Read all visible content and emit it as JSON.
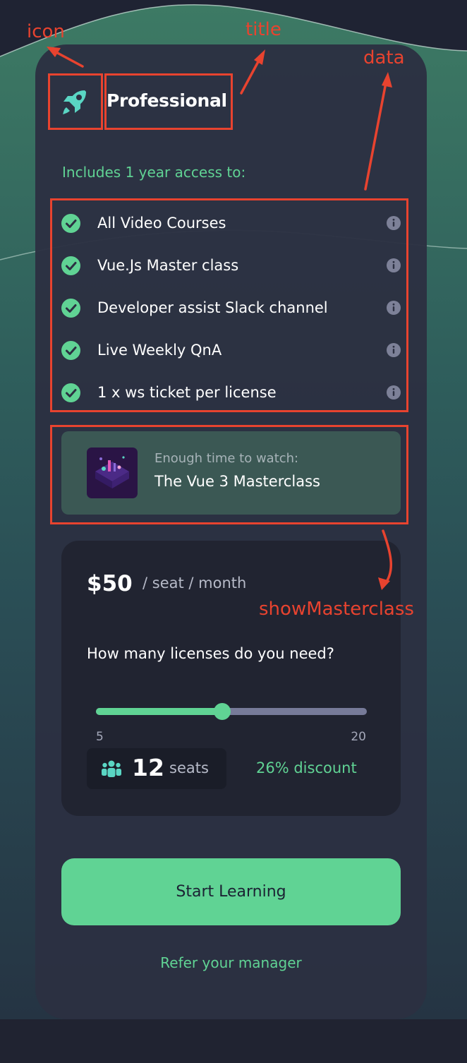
{
  "card": {
    "title": "Professional",
    "icon": "rocket-icon",
    "access_heading": "Includes 1 year access to:",
    "features": [
      {
        "label": "All Video Courses",
        "icon": "check-circle-icon"
      },
      {
        "label": "Vue.Js Master class",
        "icon": "check-circle-icon"
      },
      {
        "label": "Developer assist Slack channel",
        "icon": "check-circle-icon"
      },
      {
        "label": "Live Weekly QnA",
        "icon": "check-circle-icon"
      },
      {
        "label": "1 x ws ticket per license",
        "icon": "check-circle-icon"
      }
    ],
    "masterclass": {
      "subtitle": "Enough time to watch:",
      "title": "The Vue 3 Masterclass"
    }
  },
  "pricing": {
    "price": "$50",
    "unit": "/ seat / month",
    "question": "How many licenses do you need?",
    "slider": {
      "min": 5,
      "max": 20,
      "value": 12,
      "min_label": "5",
      "max_label": "20"
    },
    "seats_count": "12",
    "seats_label": "seats",
    "discount": "26% discount"
  },
  "actions": {
    "start_label": "Start Learning",
    "refer_label": "Refer your manager"
  },
  "annotations": {
    "icon": "icon",
    "title": "title",
    "data": "data",
    "show_masterclass": "showMasterclass"
  },
  "colors": {
    "accent": "#60d394",
    "card": "#2c3042",
    "annotation": "#e8432f"
  }
}
